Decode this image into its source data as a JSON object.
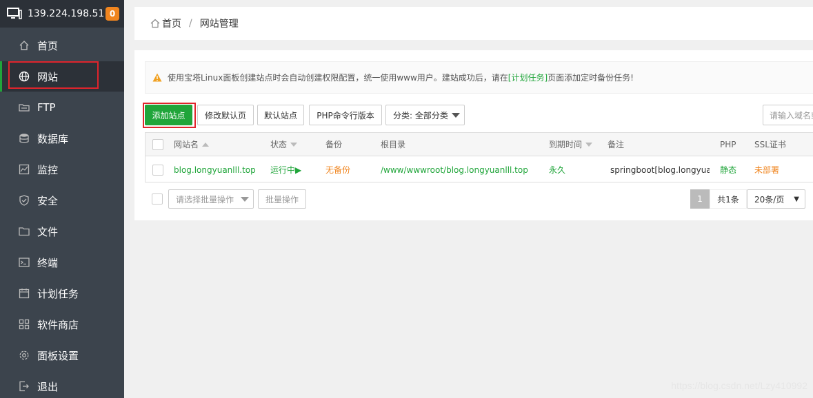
{
  "server": {
    "ip": "139.224.198.51",
    "badge": "0"
  },
  "sidebar": {
    "items": [
      {
        "label": "首页",
        "icon": "home-icon"
      },
      {
        "label": "网站",
        "icon": "globe-icon"
      },
      {
        "label": "FTP",
        "icon": "ftp-icon"
      },
      {
        "label": "数据库",
        "icon": "database-icon"
      },
      {
        "label": "监控",
        "icon": "monitor-chart-icon"
      },
      {
        "label": "安全",
        "icon": "shield-icon"
      },
      {
        "label": "文件",
        "icon": "folder-icon"
      },
      {
        "label": "终端",
        "icon": "terminal-icon"
      },
      {
        "label": "计划任务",
        "icon": "calendar-icon"
      },
      {
        "label": "软件商店",
        "icon": "grid-icon"
      },
      {
        "label": "面板设置",
        "icon": "gear-icon"
      },
      {
        "label": "退出",
        "icon": "logout-icon"
      }
    ]
  },
  "breadcrumb": {
    "home": "首页",
    "current": "网站管理"
  },
  "notice": {
    "text_before": "使用宝塔Linux面板创建站点时会自动创建权限配置，统一使用www用户。建站成功后，请在",
    "link": "[计划任务]",
    "text_after": "页面添加定时备份任务!"
  },
  "toolbar": {
    "add_site": "添加站点",
    "edit_default_page": "修改默认页",
    "default_site": "默认站点",
    "php_cli_version": "PHP命令行版本",
    "category_label": "分类: 全部分类",
    "search_placeholder": "请输入域名或备注"
  },
  "table": {
    "headers": {
      "name": "网站名",
      "status": "状态",
      "backup": "备份",
      "root": "根目录",
      "expire": "到期时间",
      "remark": "备注",
      "php": "PHP",
      "ssl": "SSL证书"
    },
    "rows": [
      {
        "name": "blog.longyuanlll.top",
        "status": "运行中▶",
        "backup": "无备份",
        "root": "/www/wwwroot/blog.longyuanlll.top",
        "expire": "永久",
        "remark": "springboot[blog.longyua",
        "php": "静态",
        "ssl": "未部署"
      }
    ]
  },
  "footer": {
    "batch_select_placeholder": "请选择批量操作",
    "batch_button": "批量操作",
    "page_current": "1",
    "total": "共1条",
    "per_page": "20条/页"
  },
  "watermark": "https://blog.csdn.net/Lzy410992",
  "colors": {
    "accent": "#20a53a",
    "warning": "#f0851f",
    "sidebar": "#3c444d",
    "highlight": "#e0242c"
  }
}
